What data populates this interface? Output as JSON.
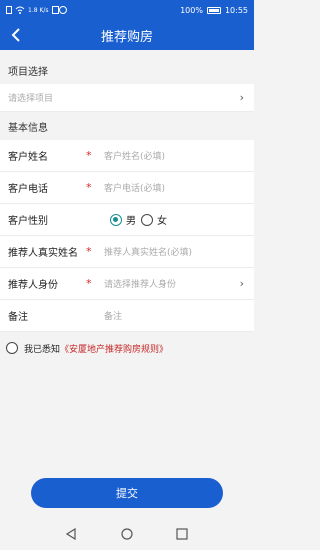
{
  "status": {
    "signal_text": "1.8 K/s",
    "battery_pct": "100%",
    "time": "10:55"
  },
  "header": {
    "title": "推荐购房",
    "back_icon": "back-arrow-icon"
  },
  "sections": {
    "project": "项目选择",
    "basic": "基本信息"
  },
  "project_select": {
    "placeholder": "请选择项目"
  },
  "form": {
    "name_label": "客户姓名",
    "name_placeholder": "客户姓名(必填)",
    "phone_label": "客户电话",
    "phone_placeholder": "客户电话(必填)",
    "gender_label": "客户性别",
    "gender_male": "男",
    "gender_female": "女",
    "referrer_name_label": "推荐人真实姓名",
    "referrer_name_placeholder": "推荐人真实姓名(必填)",
    "referrer_role_label": "推荐人身份",
    "referrer_role_placeholder": "请选择推荐人身份",
    "remark_label": "备注",
    "remark_placeholder": "备注",
    "required_mark": "*"
  },
  "agreement": {
    "prefix": "我已悉知",
    "link": "《安厦地产推荐购房规则》"
  },
  "submit_label": "提交",
  "colors": {
    "brand": "#1a5fd0",
    "required": "#d02a2a",
    "link": "#c62828",
    "radio_on": "#1a8f8f"
  }
}
